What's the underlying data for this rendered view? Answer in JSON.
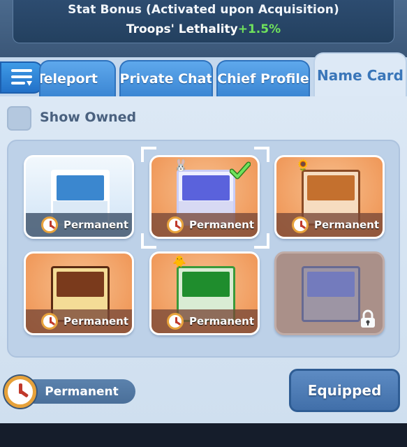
{
  "stat": {
    "title": "Stat Bonus (Activated upon Acquisition)",
    "effect_label": "Troops' Lethality",
    "effect_value": "+1.5%"
  },
  "tabs": [
    {
      "label": "Teleport",
      "active": false
    },
    {
      "label": "Private Chat",
      "active": false
    },
    {
      "label": "Chief Profile",
      "active": false
    },
    {
      "label": "Name Card",
      "active": true
    }
  ],
  "filter": {
    "show_owned_label": "Show Owned",
    "checked": false
  },
  "cards": [
    {
      "style": "blue",
      "label": "Permanent",
      "card_top": "#3b87cf",
      "card_bottom": "#dbe9f6",
      "selected": false,
      "equipped": false,
      "locked": false
    },
    {
      "style": "orange",
      "label": "Permanent",
      "card_top": "#5a62dc",
      "card_bottom": "#d7d9f3",
      "selected": true,
      "equipped": true,
      "locked": false
    },
    {
      "style": "orange",
      "label": "Permanent",
      "card_top": "#c4702e",
      "card_bottom": "#f6dcc0",
      "selected": false,
      "equipped": false,
      "locked": false
    },
    {
      "style": "orange",
      "label": "Permanent",
      "card_top": "#7a3a1c",
      "card_bottom": "#f4dc96",
      "selected": false,
      "equipped": false,
      "locked": false
    },
    {
      "style": "orange",
      "label": "Permanent",
      "card_top": "#1f8d2d",
      "card_bottom": "#d9ecd4",
      "selected": false,
      "equipped": false,
      "locked": false
    },
    {
      "style": "locked",
      "label": "",
      "card_top": "#6b72b9",
      "card_bottom": "#9a8f9d",
      "selected": false,
      "equipped": false,
      "locked": true
    }
  ],
  "bottom": {
    "duration_label": "Permanent",
    "equip_button_label": "Equipped"
  },
  "icons": {
    "menu": "filter-menu-icon",
    "clock": "clock-icon",
    "check": "checkmark-icon",
    "lock": "lock-icon"
  }
}
